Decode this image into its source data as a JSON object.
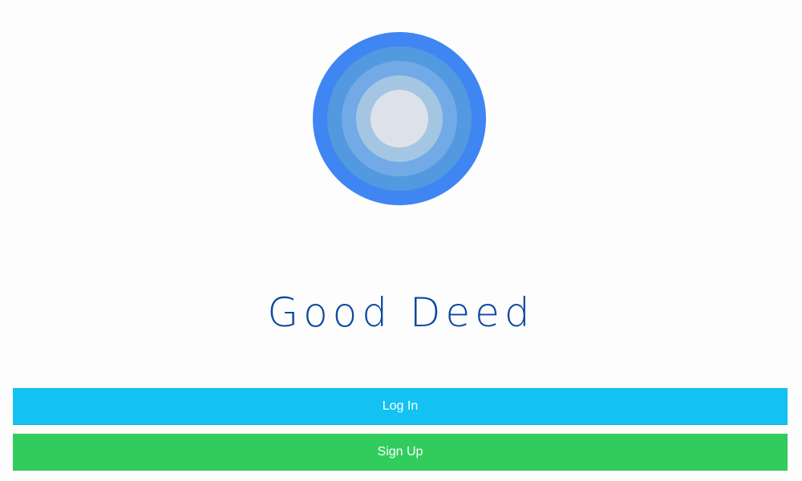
{
  "app": {
    "title": "Good Deed",
    "logo_icon": "concentric-circles-logo-icon"
  },
  "actions": {
    "login_label": "Log In",
    "signup_label": "Sign Up"
  },
  "colors": {
    "title": "#0b48a0",
    "login_button": "#13c1f2",
    "signup_button": "#32cc5c",
    "logo_rings": [
      "#3f86f2",
      "#5299e0",
      "#72aae8",
      "#a4c6e3",
      "#dde2ea"
    ]
  }
}
